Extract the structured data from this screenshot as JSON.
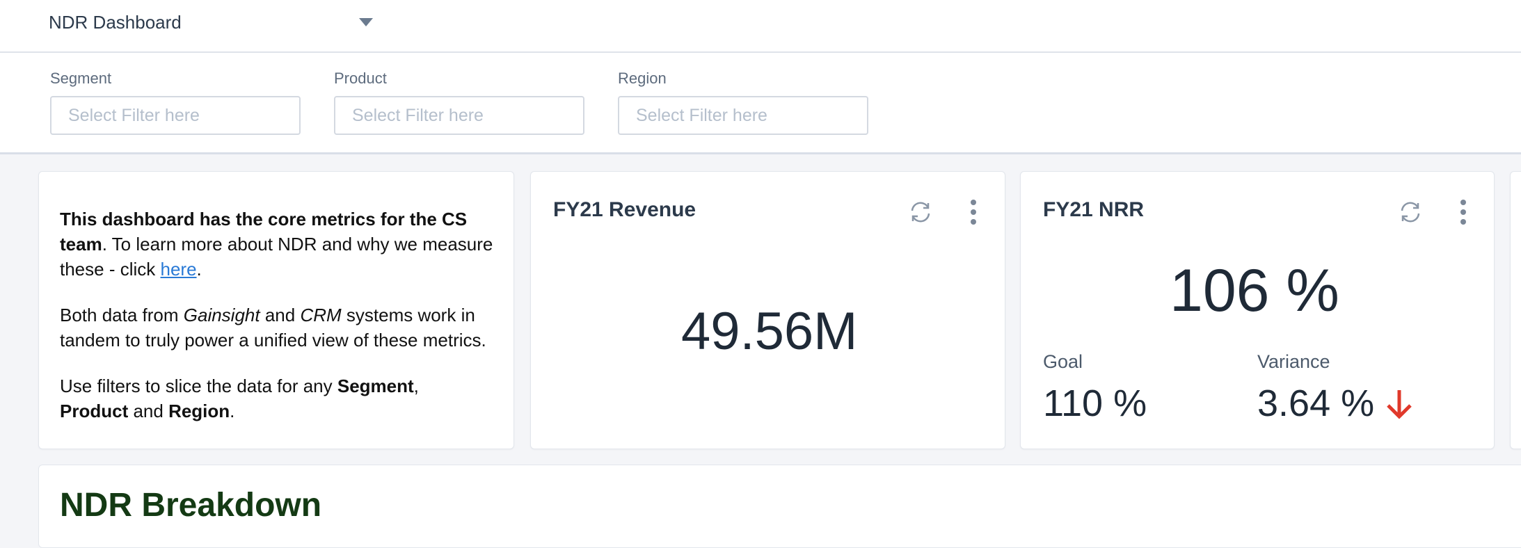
{
  "header": {
    "dashboard_name": "NDR Dashboard"
  },
  "filters": [
    {
      "label": "Segment",
      "placeholder": "Select Filter here"
    },
    {
      "label": "Product",
      "placeholder": "Select Filter here"
    },
    {
      "label": "Region",
      "placeholder": "Select Filter here"
    }
  ],
  "info_card": {
    "p1_bold": "This dashboard has the core metrics for the CS team",
    "p1_text": ". To learn more about NDR and why we measure these - click ",
    "p1_link": "here",
    "p1_end": ".",
    "p2_a": "Both data from ",
    "p2_b": "Gainsight",
    "p2_c": " and ",
    "p2_d": "CRM",
    "p2_e": " systems work in tandem to truly power a unified view of these metrics.",
    "p3_a": "Use filters to slice the data for any ",
    "p3_b": "Segment",
    "p3_c": ",",
    "p3_d": "Product",
    "p3_e": " and ",
    "p3_f": "Region",
    "p3_g": "."
  },
  "revenue_card": {
    "title": "FY21 Revenue",
    "value": "49.56M"
  },
  "nrr_card": {
    "title": "FY21 NRR",
    "value": "106 %",
    "goal_label": "Goal",
    "goal_value": "110 %",
    "variance_label": "Variance",
    "variance_value": "3.64 %"
  },
  "breakdown": {
    "title": "NDR Breakdown"
  },
  "colors": {
    "accent_link": "#2a7ad6",
    "variance_down": "#e0392b",
    "section_title": "#143a14"
  },
  "icons": {
    "refresh": "refresh-icon",
    "more": "kebab-menu-icon",
    "caret": "chevron-down-icon",
    "trend": "arrow-down-icon"
  }
}
